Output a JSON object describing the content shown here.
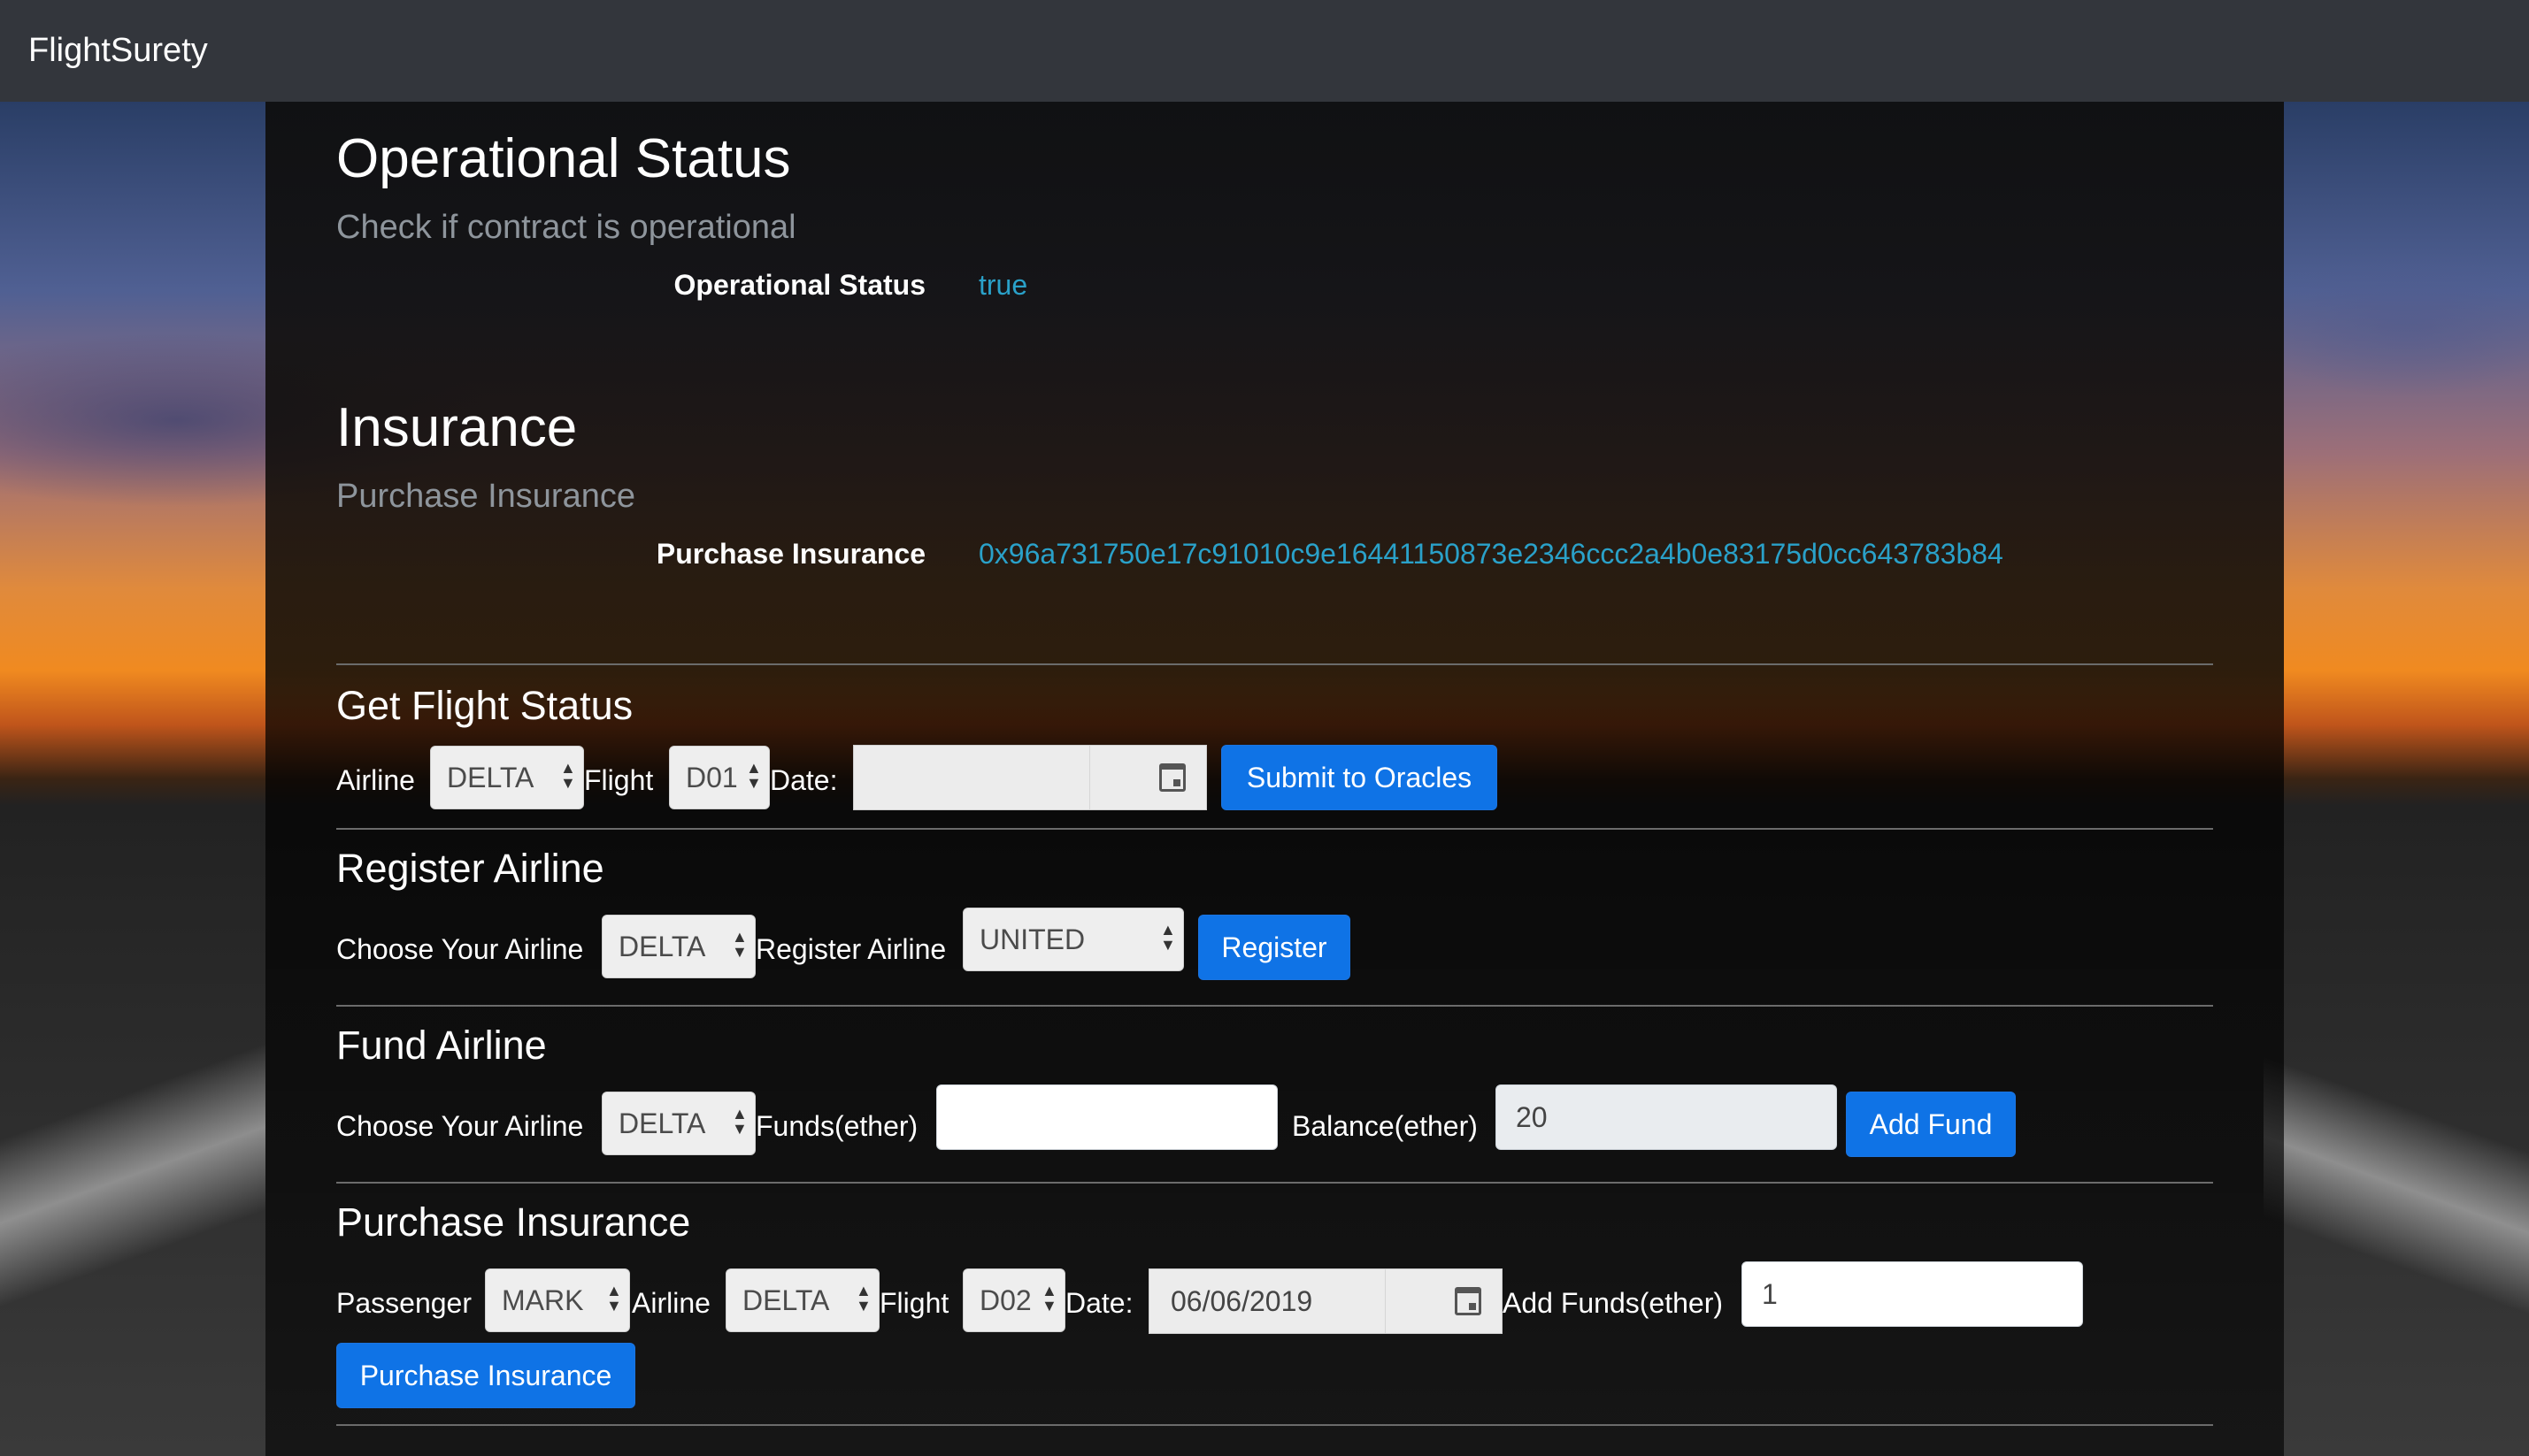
{
  "navbar": {
    "brand": "FlightSurety"
  },
  "operational": {
    "title": "Operational Status",
    "subtitle": "Check if contract is operational",
    "label": "Operational Status",
    "value": "true"
  },
  "insurance": {
    "title": "Insurance",
    "subtitle": "Purchase Insurance",
    "label": "Purchase Insurance",
    "value": "0x96a731750e17c91010c9e16441150873e2346ccc2a4b0e83175d0cc643783b84"
  },
  "flight_status": {
    "title": "Get Flight Status",
    "airline_label": "Airline",
    "airline_value": "DELTA",
    "flight_label": "Flight",
    "flight_value": "D01",
    "date_label": "Date:",
    "date_value": "",
    "submit_label": "Submit to Oracles"
  },
  "register_airline": {
    "title": "Register Airline",
    "choose_label": "Choose Your Airline",
    "choose_value": "DELTA",
    "register_label": "Register Airline",
    "register_value": "UNITED",
    "button_label": "Register"
  },
  "fund_airline": {
    "title": "Fund Airline",
    "choose_label": "Choose Your Airline",
    "choose_value": "DELTA",
    "funds_label": "Funds(ether)",
    "funds_value": "",
    "balance_label": "Balance(ether)",
    "balance_value": "20",
    "button_label": "Add Fund"
  },
  "purchase_insurance": {
    "title": "Purchase Insurance",
    "passenger_label": "Passenger",
    "passenger_value": "MARK",
    "airline_label": "Airline",
    "airline_value": "DELTA",
    "flight_label": "Flight",
    "flight_value": "D02",
    "date_label": "Date:",
    "date_value": "06/06/2019",
    "add_funds_label": "Add Funds(ether)",
    "add_funds_value": "1",
    "button_label": "Purchase Insurance"
  },
  "colors": {
    "accent": "#0f73e6",
    "link": "#2aa1c9",
    "navbar": "#33363c"
  },
  "icons": {
    "date_picker": "calendar-icon",
    "select": "updown-arrows-icon"
  }
}
